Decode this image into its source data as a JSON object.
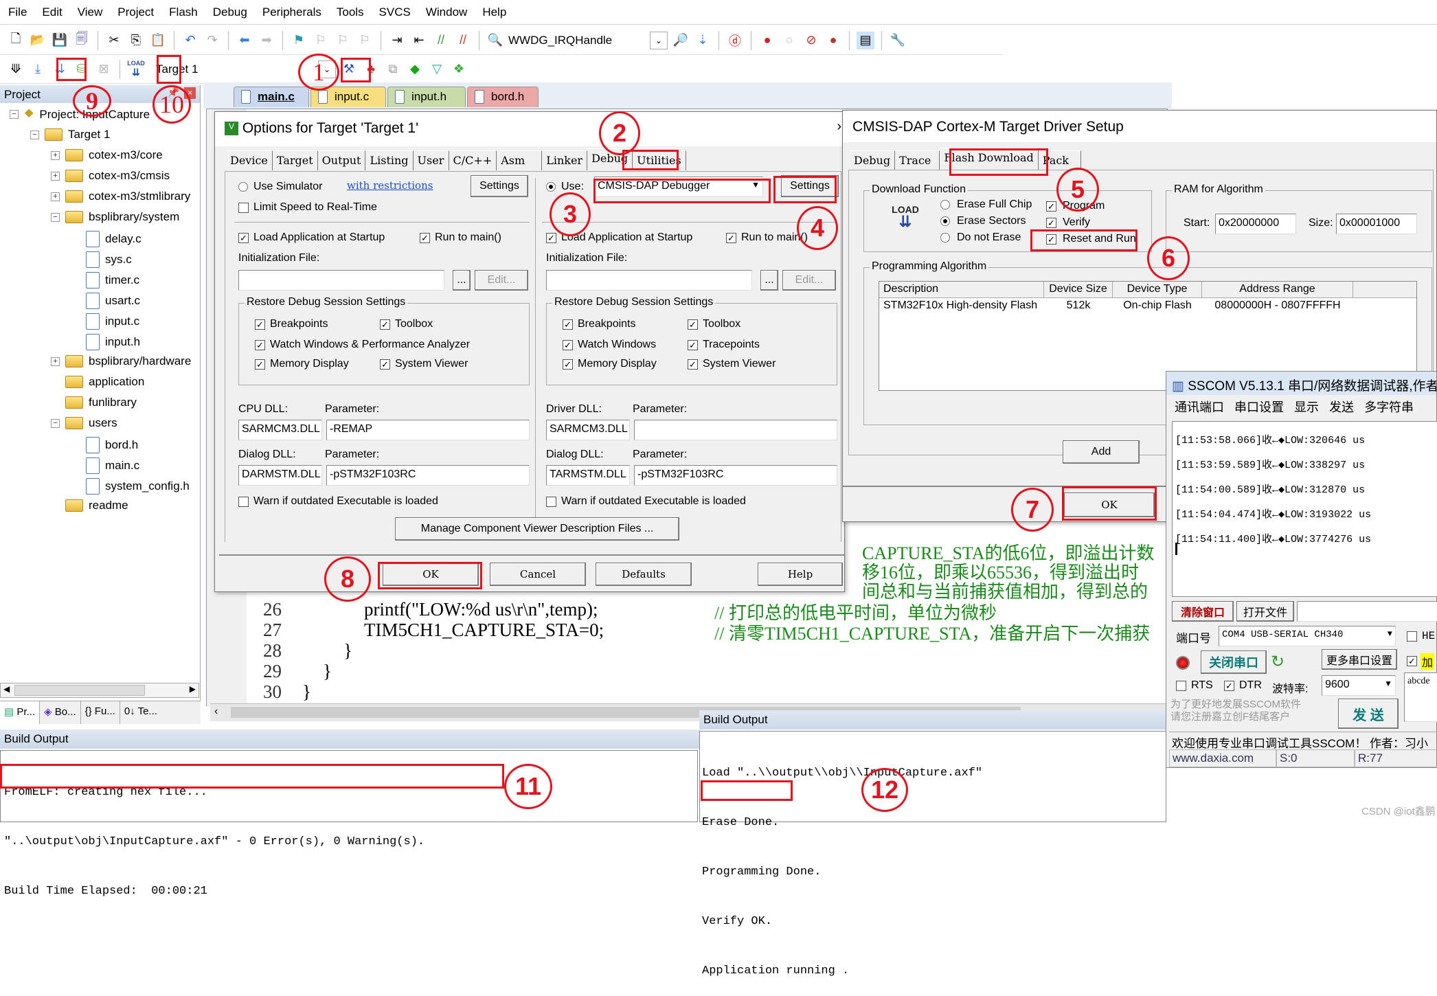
{
  "menubar": [
    "File",
    "Edit",
    "View",
    "Project",
    "Flash",
    "Debug",
    "Peripherals",
    "Tools",
    "SVCS",
    "Window",
    "Help"
  ],
  "toolbar1": {
    "function_combo": "WWDG_IRQHandle"
  },
  "toolbar2": {
    "target_combo": "Target 1",
    "load_label": "LOAD"
  },
  "project_panel": {
    "title": "Project",
    "tree": [
      {
        "label": "Project: InputCapture",
        "level": 0,
        "type": "project",
        "expanded": true
      },
      {
        "label": "Target 1",
        "level": 1,
        "type": "target",
        "expanded": true
      },
      {
        "label": "cotex-m3/core",
        "level": 2,
        "type": "folder",
        "expanded": false
      },
      {
        "label": "cotex-m3/cmsis",
        "level": 2,
        "type": "folder",
        "expanded": false
      },
      {
        "label": "cotex-m3/stmlibrary",
        "level": 2,
        "type": "folder",
        "expanded": false
      },
      {
        "label": "bsplibrary/system",
        "level": 2,
        "type": "folder",
        "expanded": true
      },
      {
        "label": "delay.c",
        "level": 3,
        "type": "file"
      },
      {
        "label": "sys.c",
        "level": 3,
        "type": "file"
      },
      {
        "label": "timer.c",
        "level": 3,
        "type": "file"
      },
      {
        "label": "usart.c",
        "level": 3,
        "type": "file"
      },
      {
        "label": "input.c",
        "level": 3,
        "type": "file"
      },
      {
        "label": "input.h",
        "level": 3,
        "type": "file"
      },
      {
        "label": "bsplibrary/hardware",
        "level": 2,
        "type": "folder",
        "expanded": false
      },
      {
        "label": "application",
        "level": 2,
        "type": "folder"
      },
      {
        "label": "funlibrary",
        "level": 2,
        "type": "folder"
      },
      {
        "label": "users",
        "level": 2,
        "type": "folder",
        "expanded": true
      },
      {
        "label": "bord.h",
        "level": 3,
        "type": "file"
      },
      {
        "label": "main.c",
        "level": 3,
        "type": "file"
      },
      {
        "label": "system_config.h",
        "level": 3,
        "type": "file"
      },
      {
        "label": "readme",
        "level": 2,
        "type": "folder"
      }
    ],
    "bottom_tabs": [
      "Pr...",
      "Bo...",
      "{} Fu...",
      "0↓ Te..."
    ]
  },
  "editor": {
    "tabs": [
      {
        "label": "main.c",
        "color": "#c9d8ef",
        "active": true
      },
      {
        "label": "input.c",
        "color": "#f7df7e"
      },
      {
        "label": "input.h",
        "color": "#c8dba8"
      },
      {
        "label": "bord.h",
        "color": "#eea7a7"
      }
    ],
    "lines": [
      {
        "n": "26",
        "code": "printf(\"LOW:%d us\\r\\n\",temp);",
        "comment": "// 打印总的低电平时间，单位为微秒"
      },
      {
        "n": "27",
        "code": "TIM5CH1_CAPTURE_STA=0;",
        "comment": "// 清零TIM5CH1_CAPTURE_STA，准备开启下一次捕获"
      },
      {
        "n": "28",
        "code": "}",
        "comment": ""
      },
      {
        "n": "29",
        "code": "}",
        "comment": ""
      },
      {
        "n": "30",
        "code": "}",
        "comment": ""
      }
    ],
    "partial_comments": [
      "CAPTURE_STA的低6位，即溢出计数",
      "移16位，即乘以65536，得到溢出时",
      "间总和与当前捕获值相加，得到总的"
    ]
  },
  "options_dialog": {
    "title": "Options for Target 'Target 1'",
    "tabs": [
      "Device",
      "Target",
      "Output",
      "Listing",
      "User",
      "C/C++",
      "Asm",
      "Linker",
      "Debug",
      "Utilities"
    ],
    "active_tab": "Debug",
    "left": {
      "use_simulator": "Use Simulator",
      "with_restrictions": "with restrictions",
      "settings": "Settings",
      "limit_speed": "Limit Speed to Real-Time",
      "load_app": "Load Application at Startup",
      "run_to_main": "Run to main()",
      "init_file": "Initialization File:",
      "browse": "...",
      "edit": "Edit...",
      "restore_group": "Restore Debug Session Settings",
      "breakpoints": "Breakpoints",
      "toolbox": "Toolbox",
      "watch": "Watch Windows & Performance Analyzer",
      "memory": "Memory Display",
      "sysviewer": "System Viewer",
      "cpu_dll_label": "CPU DLL:",
      "param_label": "Parameter:",
      "cpu_dll": "SARMCM3.DLL",
      "cpu_param": "-REMAP",
      "dialog_dll_label": "Dialog DLL:",
      "dialog_dll": "DARMSTM.DLL",
      "dialog_param": "-pSTM32F103RC",
      "warn": "Warn if outdated Executable is loaded"
    },
    "right": {
      "use": "Use:",
      "debugger": "CMSIS-DAP Debugger",
      "settings": "Settings",
      "load_app": "Load Application at Startup",
      "run_to_main": "Run to main()",
      "init_file": "Initialization File:",
      "browse": "...",
      "edit": "Edit...",
      "restore_group": "Restore Debug Session Settings",
      "breakpoints": "Breakpoints",
      "toolbox": "Toolbox",
      "watch": "Watch Windows",
      "tracepoints": "Tracepoints",
      "memory": "Memory Display",
      "sysviewer": "System Viewer",
      "driver_dll_label": "Driver DLL:",
      "param_label": "Parameter:",
      "driver_dll": "SARMCM3.DLL",
      "driver_param": "",
      "dialog_dll_label": "Dialog DLL:",
      "dialog_dll": "TARMSTM.DLL",
      "dialog_param": "-pSTM32F103RC",
      "warn": "Warn if outdated Executable is loaded"
    },
    "manage_button": "Manage Component Viewer Description Files ...",
    "buttons": {
      "ok": "OK",
      "cancel": "Cancel",
      "defaults": "Defaults",
      "help": "Help"
    }
  },
  "driver_dialog": {
    "title": "CMSIS-DAP Cortex-M Target Driver Setup",
    "tabs": [
      "Debug",
      "Trace",
      "Flash Download",
      "Pack"
    ],
    "active_tab": "Flash Download",
    "download_group": "Download Function",
    "load_icon": "LOAD",
    "erase_full": "Erase Full Chip",
    "erase_sectors": "Erase Sectors",
    "do_not_erase": "Do not Erase",
    "program": "Program",
    "verify": "Verify",
    "reset_run": "Reset and Run",
    "ram_group": "RAM for Algorithm",
    "start_label": "Start:",
    "start": "0x20000000",
    "size_label": "Size:",
    "size": "0x00001000",
    "algo_group": "Programming Algorithm",
    "columns": [
      "Description",
      "Device Size",
      "Device Type",
      "Address Range"
    ],
    "rows": [
      [
        "STM32F10x High-density Flash",
        "512k",
        "On-chip Flash",
        "08000000H - 0807FFFFH"
      ]
    ],
    "add": "Add",
    "ok": "OK"
  },
  "build_output_left": {
    "title": "Build Output",
    "lines": [
      "FromELF: creating hex file...",
      "\"..\\output\\obj\\InputCapture.axf\" - 0 Error(s), 0 Warning(s).",
      "Build Time Elapsed:  00:00:21"
    ]
  },
  "build_output_right": {
    "title": "Build Output",
    "lines": [
      "Load \"..\\\\output\\\\obj\\\\InputCapture.axf\"",
      "Erase Done.",
      "Programming Done.",
      "Verify OK.",
      "Application running ."
    ]
  },
  "sscom": {
    "title": "SSCOM V5.13.1 串口/网络数据调试器,作者",
    "menu": [
      "通讯端口",
      "串口设置",
      "显示",
      "发送",
      "多字符串"
    ],
    "log": [
      "[11:53:58.066]收←◆LOW:320646 us",
      "[11:53:59.589]收←◆LOW:338297 us",
      "[11:54:00.589]收←◆LOW:312870 us",
      "[11:54:04.474]收←◆LOW:3193022 us",
      "[11:54:11.400]收←◆LOW:3774276 us"
    ],
    "clear_btn": "清除窗口",
    "open_file_btn": "打开文件",
    "port_label": "端口号",
    "port": "COM4 USB-SERIAL CH340",
    "close_port_btn": "关闭串口",
    "more_settings_btn": "更多串口设置",
    "rts": "RTS",
    "dtr": "DTR",
    "baud_label": "波特率:",
    "baud": "9600",
    "hex_label": "HE",
    "add_label": "加",
    "send_preview": "abcde",
    "promo": "为了更好地发展SSCOM软件\n请您注册嘉立创F结尾客户",
    "send_btn": "发  送",
    "welcome": "欢迎使用专业串口调试工具SSCOM！  作者：习小",
    "status_url": "www.daxia.com",
    "status_s": "S:0",
    "status_r": "R:77"
  },
  "annotations": [
    "1",
    "2",
    "3",
    "4",
    "5",
    "6",
    "7",
    "8",
    "9",
    "10",
    "11",
    "12"
  ],
  "watermark": "CSDN @iot鑫鹏"
}
